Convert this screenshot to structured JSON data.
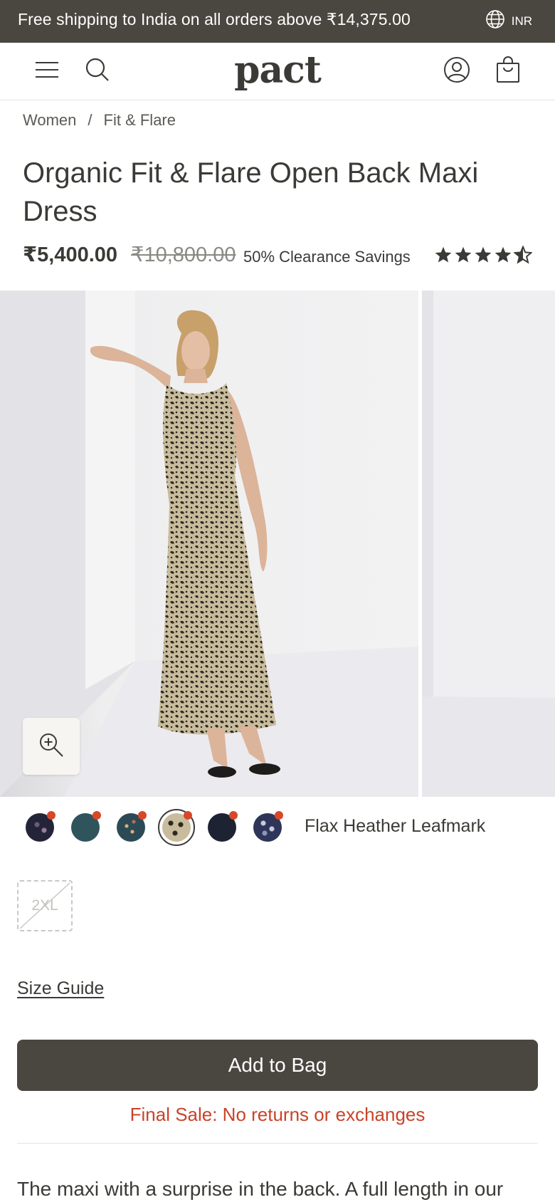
{
  "announcement": {
    "text": "Free shipping to India on all orders above ₹14,375.00",
    "currency": "INR",
    "icon": "globe-icon"
  },
  "header": {
    "logo": "pact",
    "icons": [
      "menu-icon",
      "search-icon",
      "account-icon",
      "bag-icon"
    ]
  },
  "breadcrumb": {
    "items": [
      "Women",
      "Fit & Flare"
    ],
    "separator": "/"
  },
  "product": {
    "title": "Organic Fit & Flare Open Back Maxi Dress",
    "price": "₹5,400.00",
    "compare_price": "₹10,800.00",
    "savings": "50% Clearance Savings",
    "rating_stars": 4.5,
    "rating_max": 5
  },
  "gallery": {
    "zoom_icon": "zoom-in-icon"
  },
  "colors": {
    "selected_name": "Flax Heather Leafmark",
    "swatches": [
      {
        "color": "#232437",
        "sale": true
      },
      {
        "color": "#2f545c",
        "sale": true
      },
      {
        "color": "#2c4a55",
        "sale": true
      },
      {
        "color": "#9c8e70",
        "sale": true,
        "selected": true
      },
      {
        "color": "#1e2333",
        "sale": true
      },
      {
        "color": "#2e3558",
        "sale": true
      }
    ],
    "sale_dot_color": "#d8472a"
  },
  "sizes": [
    {
      "label": "2XL",
      "available": false
    }
  ],
  "size_guide": "Size Guide",
  "add_to_bag": "Add to Bag",
  "final_sale": "Final Sale: No returns or exchanges",
  "description": "The maxi with a surprise in the back. A full length in our",
  "colors_theme": {
    "dark": "#4a4740",
    "text": "#3b3a36",
    "alert": "#c8432a"
  }
}
